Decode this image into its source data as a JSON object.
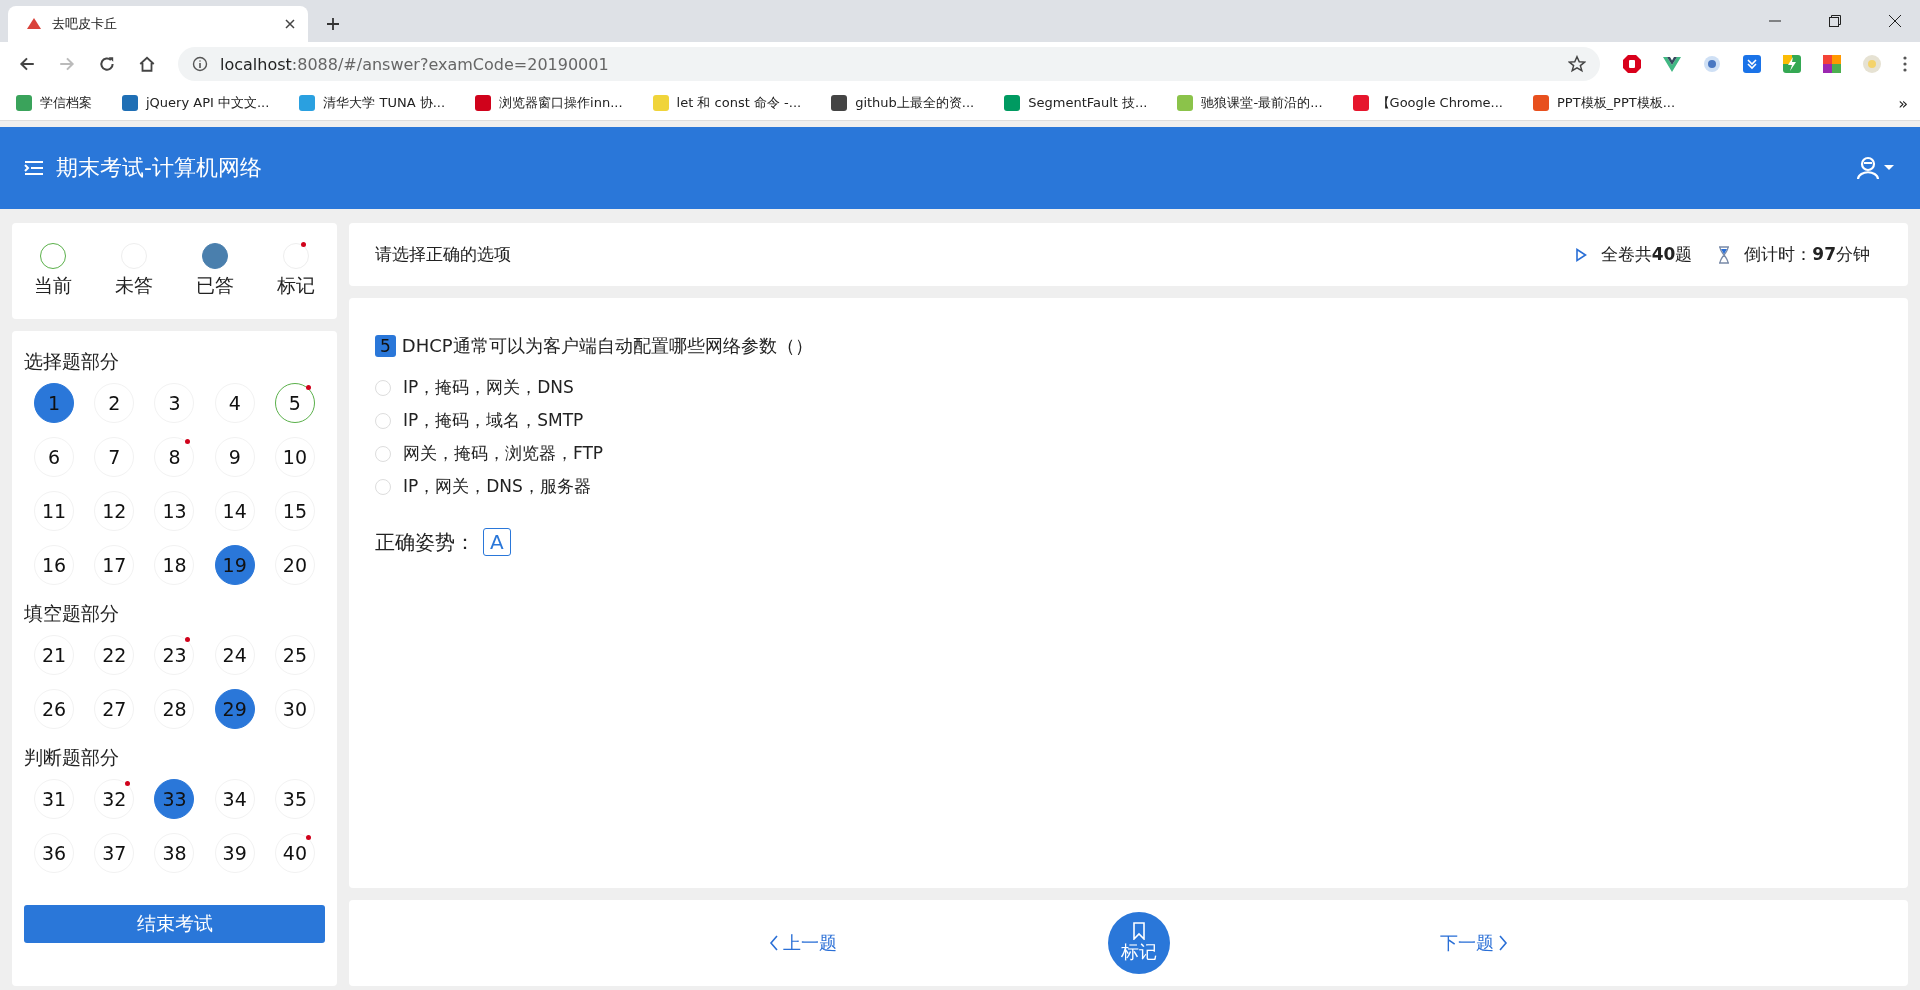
{
  "browser": {
    "tab": {
      "title": "去吧皮卡丘"
    },
    "url_host": "localhost",
    "url_rest": ":8088/#/answer?examCode=20190001",
    "bookmarks": [
      {
        "label": "学信档案",
        "color": "#3aa35b"
      },
      {
        "label": "jQuery API 中文文...",
        "color": "#1f6fb5"
      },
      {
        "label": "清华大学 TUNA 协...",
        "color": "#2aa0e0"
      },
      {
        "label": "浏览器窗口操作inn...",
        "color": "#d0021b"
      },
      {
        "label": "let 和 const 命令 -...",
        "color": "#f0d43a"
      },
      {
        "label": "github上最全的资...",
        "color": "#444444"
      },
      {
        "label": "SegmentFault 技...",
        "color": "#009a61"
      },
      {
        "label": "驰狼课堂-最前沿的...",
        "color": "#8bc34a"
      },
      {
        "label": "【Google Chrome...",
        "color": "#e6162d"
      },
      {
        "label": "PPT模板_PPT模板...",
        "color": "#e8501e"
      }
    ],
    "more": "»"
  },
  "header": {
    "title": "期末考试-计算机网络"
  },
  "legend": [
    {
      "kind": "current",
      "label": "当前"
    },
    {
      "kind": "unanswered",
      "label": "未答"
    },
    {
      "kind": "answered",
      "label": "已答"
    },
    {
      "kind": "marked",
      "label": "标记"
    }
  ],
  "sections": [
    {
      "title": "选择题部分",
      "questions": [
        {
          "num": "1",
          "answered": true,
          "current": false,
          "marked": false
        },
        {
          "num": "2",
          "answered": false,
          "current": false,
          "marked": false
        },
        {
          "num": "3",
          "answered": false,
          "current": false,
          "marked": false
        },
        {
          "num": "4",
          "answered": false,
          "current": false,
          "marked": false
        },
        {
          "num": "5",
          "answered": false,
          "current": true,
          "marked": true
        },
        {
          "num": "6",
          "answered": false,
          "current": false,
          "marked": false
        },
        {
          "num": "7",
          "answered": false,
          "current": false,
          "marked": false
        },
        {
          "num": "8",
          "answered": false,
          "current": false,
          "marked": true
        },
        {
          "num": "9",
          "answered": false,
          "current": false,
          "marked": false
        },
        {
          "num": "10",
          "answered": false,
          "current": false,
          "marked": false
        },
        {
          "num": "11",
          "answered": false,
          "current": false,
          "marked": false
        },
        {
          "num": "12",
          "answered": false,
          "current": false,
          "marked": false
        },
        {
          "num": "13",
          "answered": false,
          "current": false,
          "marked": false
        },
        {
          "num": "14",
          "answered": false,
          "current": false,
          "marked": false
        },
        {
          "num": "15",
          "answered": false,
          "current": false,
          "marked": false
        },
        {
          "num": "16",
          "answered": false,
          "current": false,
          "marked": false
        },
        {
          "num": "17",
          "answered": false,
          "current": false,
          "marked": false
        },
        {
          "num": "18",
          "answered": false,
          "current": false,
          "marked": false
        },
        {
          "num": "19",
          "answered": true,
          "current": false,
          "marked": false
        },
        {
          "num": "20",
          "answered": false,
          "current": false,
          "marked": false
        }
      ]
    },
    {
      "title": "填空题部分",
      "questions": [
        {
          "num": "21",
          "answered": false,
          "current": false,
          "marked": false
        },
        {
          "num": "22",
          "answered": false,
          "current": false,
          "marked": false
        },
        {
          "num": "23",
          "answered": false,
          "current": false,
          "marked": true
        },
        {
          "num": "24",
          "answered": false,
          "current": false,
          "marked": false
        },
        {
          "num": "25",
          "answered": false,
          "current": false,
          "marked": false
        },
        {
          "num": "26",
          "answered": false,
          "current": false,
          "marked": false
        },
        {
          "num": "27",
          "answered": false,
          "current": false,
          "marked": false
        },
        {
          "num": "28",
          "answered": false,
          "current": false,
          "marked": false
        },
        {
          "num": "29",
          "answered": true,
          "current": false,
          "marked": false
        },
        {
          "num": "30",
          "answered": false,
          "current": false,
          "marked": false
        }
      ]
    },
    {
      "title": "判断题部分",
      "questions": [
        {
          "num": "31",
          "answered": false,
          "current": false,
          "marked": false
        },
        {
          "num": "32",
          "answered": false,
          "current": false,
          "marked": true
        },
        {
          "num": "33",
          "answered": true,
          "current": false,
          "marked": false
        },
        {
          "num": "34",
          "answered": false,
          "current": false,
          "marked": false
        },
        {
          "num": "35",
          "answered": false,
          "current": false,
          "marked": false
        },
        {
          "num": "36",
          "answered": false,
          "current": false,
          "marked": false
        },
        {
          "num": "37",
          "answered": false,
          "current": false,
          "marked": false
        },
        {
          "num": "38",
          "answered": false,
          "current": false,
          "marked": false
        },
        {
          "num": "39",
          "answered": false,
          "current": false,
          "marked": false
        },
        {
          "num": "40",
          "answered": false,
          "current": false,
          "marked": true
        }
      ]
    }
  ],
  "finish_button": "结束考试",
  "info_bar": {
    "instruction": "请选择正确的选项",
    "total": "全卷共**40**题",
    "countdown": "倒计时：**97**分钟"
  },
  "question": {
    "number": "5",
    "text": "DHCP通常可以为客户端自动配置哪些网络参数（）",
    "options": [
      {
        "text": "IP，掩码，网关，DNS",
        "selected": false
      },
      {
        "text": "IP，掩码，域名，SMTP",
        "selected": false
      },
      {
        "text": "网关，掩码，浏览器，FTP",
        "selected": false
      },
      {
        "text": "IP，网关，DNS，服务器",
        "selected": false
      }
    ],
    "answer_label": "正确姿势：",
    "answer": "A"
  },
  "nav": {
    "prev": "上一题",
    "mark": "标记",
    "next": "下一题"
  }
}
